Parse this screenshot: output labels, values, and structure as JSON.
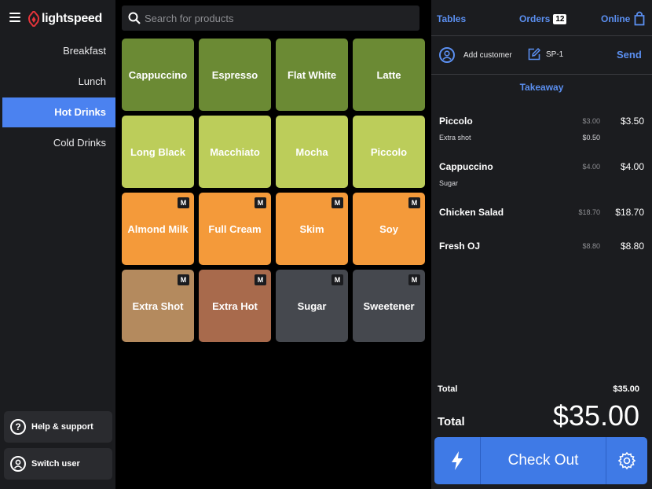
{
  "brand": {
    "name": "lightspeed",
    "accent": "#4b82f0"
  },
  "sidebar": {
    "categories": [
      {
        "label": "Breakfast",
        "active": false
      },
      {
        "label": "Lunch",
        "active": false
      },
      {
        "label": "Hot Drinks",
        "active": true
      },
      {
        "label": "Cold Drinks",
        "active": false
      }
    ],
    "help_label": "Help & support",
    "switch_user_label": "Switch user"
  },
  "search": {
    "placeholder": "Search for products",
    "value": ""
  },
  "products": [
    {
      "label": "Cappuccino",
      "color": "#6b8a34",
      "modifier": false
    },
    {
      "label": "Espresso",
      "color": "#6b8a34",
      "modifier": false
    },
    {
      "label": "Flat White",
      "color": "#6b8a34",
      "modifier": false
    },
    {
      "label": "Latte",
      "color": "#6b8a34",
      "modifier": false
    },
    {
      "label": "Long Black",
      "color": "#bccd5a",
      "modifier": false
    },
    {
      "label": "Macchiato",
      "color": "#bccd5a",
      "modifier": false
    },
    {
      "label": "Mocha",
      "color": "#bccd5a",
      "modifier": false
    },
    {
      "label": "Piccolo",
      "color": "#bccd5a",
      "modifier": false
    },
    {
      "label": "Almond Milk",
      "color": "#f49a3a",
      "modifier": true
    },
    {
      "label": "Full Cream",
      "color": "#f49a3a",
      "modifier": true
    },
    {
      "label": "Skim",
      "color": "#f49a3a",
      "modifier": true
    },
    {
      "label": "Soy",
      "color": "#f49a3a",
      "modifier": true
    },
    {
      "label": "Extra Shot",
      "color": "#b48a5e",
      "modifier": true
    },
    {
      "label": "Extra Hot",
      "color": "#a86a4c",
      "modifier": true
    },
    {
      "label": "Sugar",
      "color": "#45484e",
      "modifier": true
    },
    {
      "label": "Sweetener",
      "color": "#45484e",
      "modifier": true
    }
  ],
  "modifier_badge": "M",
  "order": {
    "tabs": {
      "tables": "Tables",
      "orders": "Orders",
      "orders_count": "12",
      "online": "Online"
    },
    "add_customer": "Add customer",
    "order_id": "SP-1",
    "send": "Send",
    "mode": "Takeaway",
    "line_items": [
      {
        "name": "Piccolo",
        "unit": "$3.00",
        "price": "$3.50",
        "mod": "Extra shot",
        "mod_price": "$0.50"
      },
      {
        "name": "Cappuccino",
        "unit": "$4.00",
        "price": "$4.00",
        "mod": "Sugar",
        "mod_price": ""
      },
      {
        "name": "Chicken Salad",
        "unit": "$18.70",
        "price": "$18.70",
        "mod": "",
        "mod_price": ""
      },
      {
        "name": "Fresh OJ",
        "unit": "$8.80",
        "price": "$8.80",
        "mod": "",
        "mod_price": ""
      }
    ],
    "subtotal_label": "Total",
    "subtotal_value": "$35.00",
    "total_label": "Total",
    "total_value": "$35.00",
    "checkout_label": "Check Out"
  }
}
